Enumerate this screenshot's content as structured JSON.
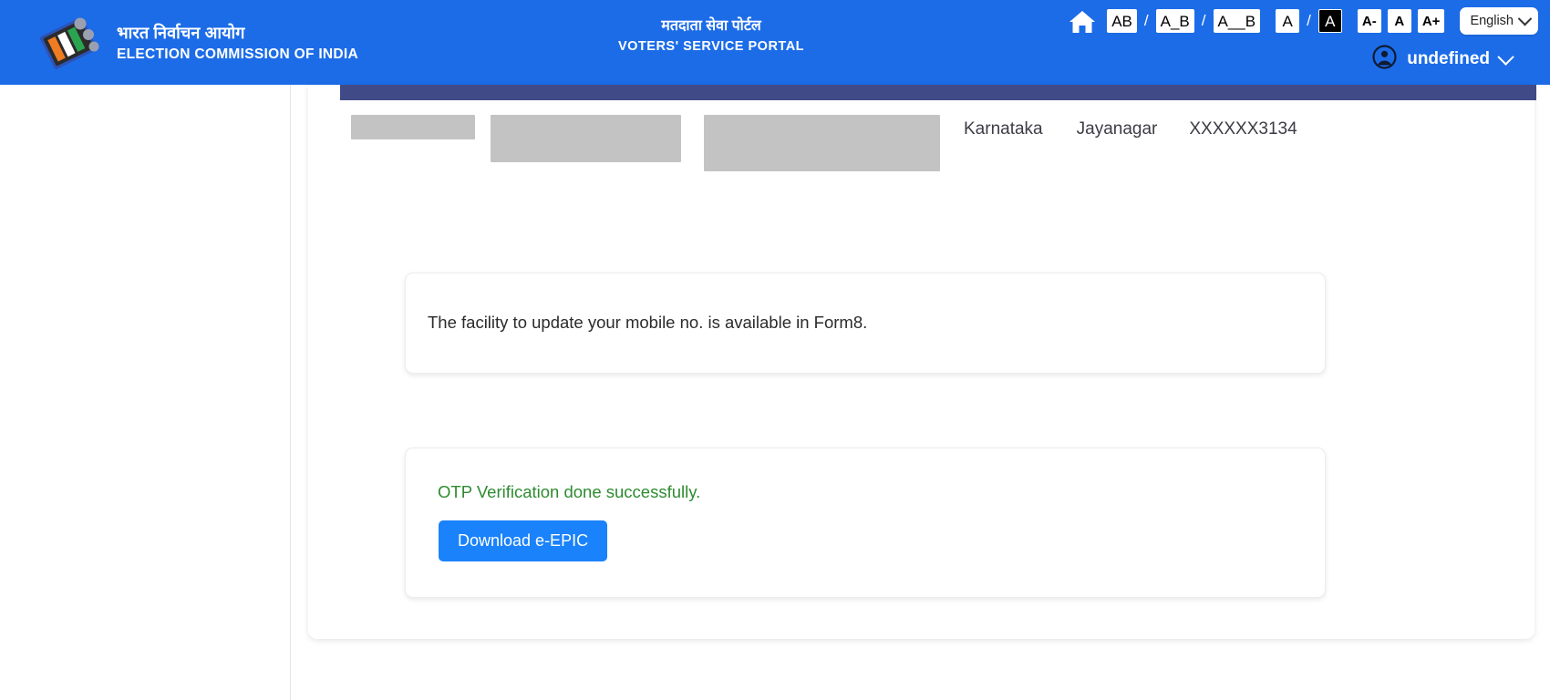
{
  "header": {
    "brand": {
      "logo_icon": "eci-ballot-logo",
      "title_hi": "भारत निर्वाचन आयोग",
      "title_en": "ELECTION COMMISSION OF INDIA"
    },
    "portal": {
      "title_hi": "मतदाता सेवा पोर्टल",
      "title_en": "VOTERS' SERVICE PORTAL"
    },
    "accessibility": {
      "home_icon": "home-icon",
      "spacing_options": [
        {
          "label": "AB",
          "name": "letter-spacing-normal"
        },
        {
          "label": "A_B",
          "name": "letter-spacing-medium"
        },
        {
          "label": "A__B",
          "name": "letter-spacing-wide"
        }
      ],
      "separator": "/",
      "contrast_options": [
        {
          "label": "A",
          "name": "contrast-normal",
          "active": false
        },
        {
          "label": "A",
          "name": "contrast-inverted",
          "active": true
        }
      ],
      "font_size_options": [
        {
          "label": "A-",
          "name": "font-size-decrease"
        },
        {
          "label": "A",
          "name": "font-size-default"
        },
        {
          "label": "A+",
          "name": "font-size-increase"
        }
      ]
    },
    "language": {
      "selected": "English",
      "chevron_icon": "chevron-down-icon"
    },
    "user": {
      "avatar_icon": "account-circle-icon",
      "name": "undefined",
      "chevron_icon": "chevron-down-icon"
    },
    "colors": {
      "header_bg": "#1c6ce8",
      "navy_bar": "#3f4a87"
    }
  },
  "content": {
    "voter_info": {
      "redacted_fields": [
        {
          "name": "redacted-field-1"
        },
        {
          "name": "redacted-field-2"
        },
        {
          "name": "redacted-field-3"
        }
      ],
      "state": "Karnataka",
      "constituency": "Jayanagar",
      "epic_number": "XXXXXX3134"
    },
    "notice": {
      "message": "The facility to update your mobile no. is available in Form8."
    },
    "otp": {
      "status_message": "OTP Verification done successfully.",
      "status_color": "#2e8b30",
      "download_button_label": "Download e-EPIC",
      "download_button_color": "#1a82fb"
    }
  }
}
